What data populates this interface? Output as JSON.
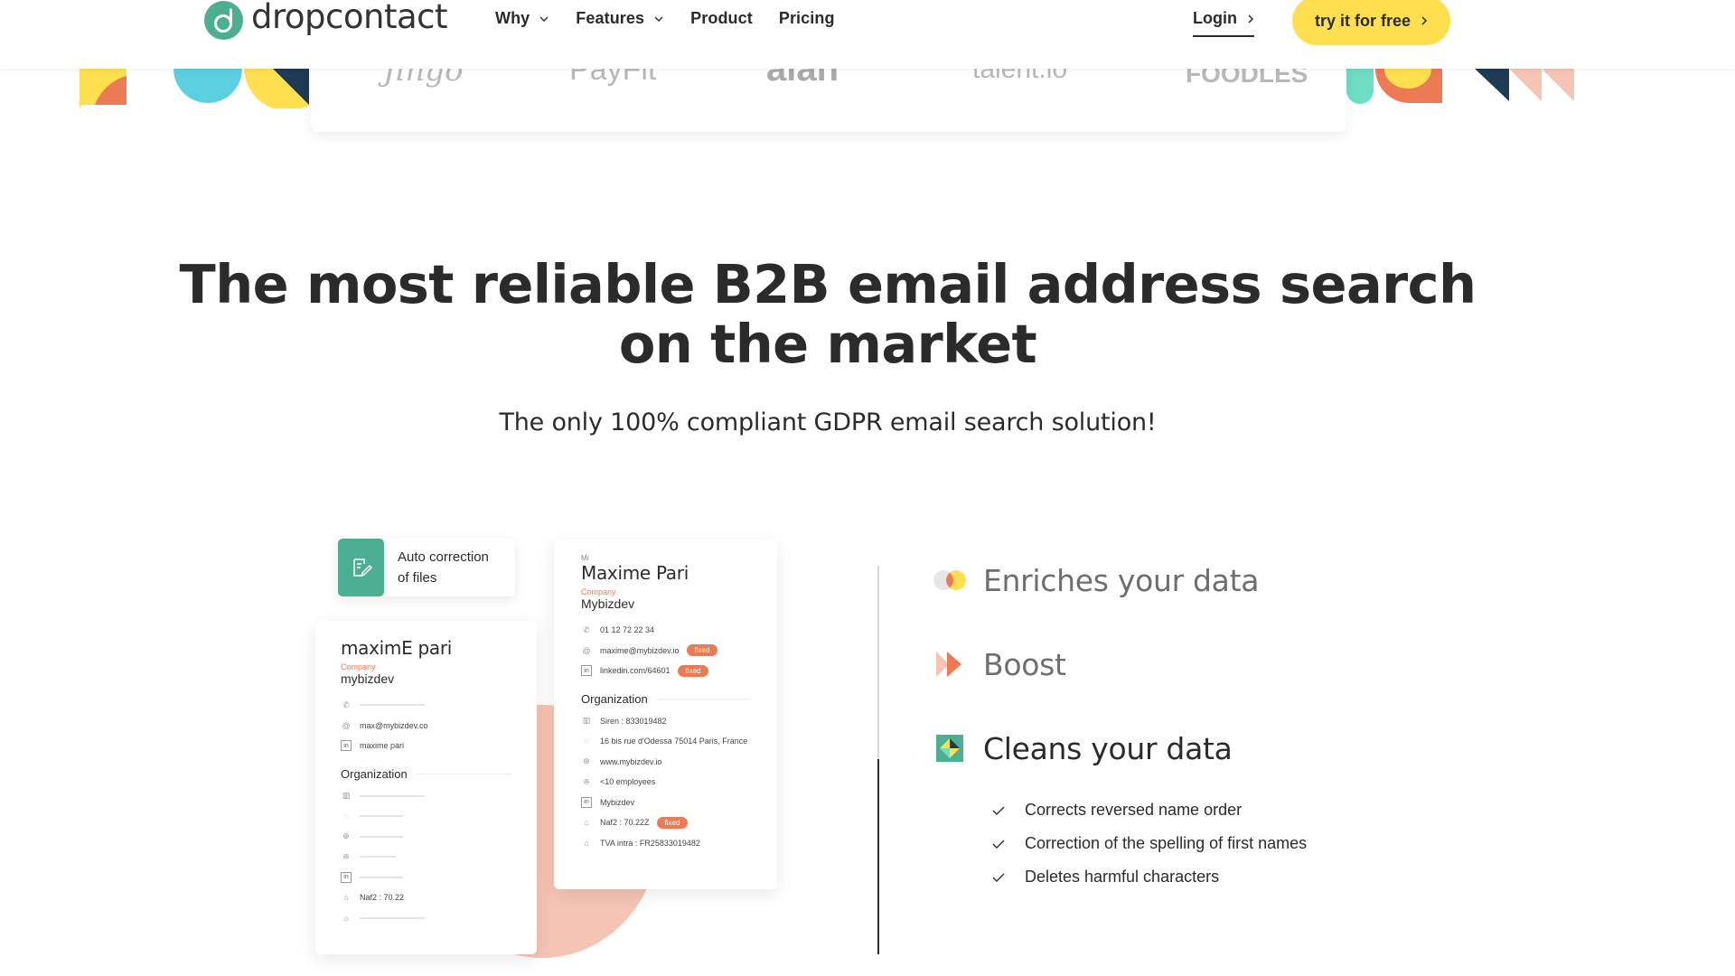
{
  "header": {
    "logo_text": "dropcontact",
    "nav": [
      {
        "label": "Why",
        "has_dropdown": true
      },
      {
        "label": "Features",
        "has_dropdown": true
      },
      {
        "label": "Product",
        "has_dropdown": false
      },
      {
        "label": "Pricing",
        "has_dropdown": false
      }
    ],
    "login_label": "Login",
    "cta_label": "try it for free"
  },
  "clients": [
    "Jingo",
    "PayFit",
    "alan",
    "talent.io",
    "FOODLES"
  ],
  "hero": {
    "title_line1": "The most reliable B2B email address search",
    "title_line2": "on the market",
    "subtitle": "The only 100% compliant GDPR email search solution!"
  },
  "illustration": {
    "auto_correction_line1": "Auto correction",
    "auto_correction_line2": "of files",
    "before_card": {
      "name": "maximE pari",
      "company_label": "Company",
      "company": "mybizdev",
      "email": "max@mybizdev.co",
      "linkedin": "maxime pari",
      "org_title": "Organization",
      "naf": "Naf2 : 70.22"
    },
    "after_card": {
      "salutation": "Mr",
      "name": "Maxime Pari",
      "company_label": "Company",
      "company": "Mybizdev",
      "phone": "01 12 72 22 34",
      "email": "maxime@mybizdev.io",
      "linkedin": "linkedin.com/64601",
      "fixed_label": "fixed",
      "org_title": "Organization",
      "siren": "Siren : 833019482",
      "address": "16 bis rue d'Odessa 75014 Paris, France",
      "website": "www.mybizdev.io",
      "employees": "<10 employees",
      "org_linkedin": "Mybizdev",
      "naf": "Naf2 : 70.22Z",
      "tva": "TVA intra : FR25833019482"
    }
  },
  "features": [
    {
      "label": "Enriches your data",
      "active": false
    },
    {
      "label": "Boost",
      "active": false
    },
    {
      "label": "Cleans your data",
      "active": true
    }
  ],
  "clean_checks": [
    "Corrects reversed name order",
    "Correction of the spelling of first names",
    "Deletes harmful characters"
  ],
  "colors": {
    "brand_green": "#4caf92",
    "cta_yellow": "#fddf4f",
    "accent_orange": "#ec7a55",
    "peach": "#f5c4b4",
    "navy": "#1f3a55",
    "teal": "#5ccfe0"
  }
}
